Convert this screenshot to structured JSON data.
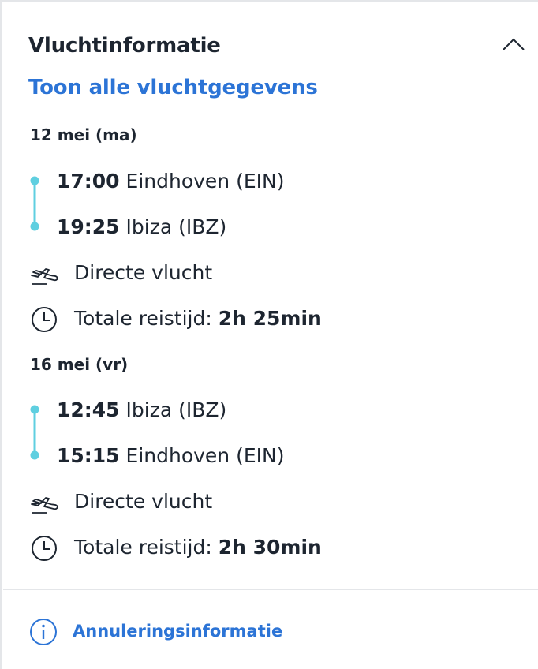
{
  "panel": {
    "title": "Vluchtinformatie",
    "show_all_link": "Toon alle vluchtgegevens",
    "accent_color": "#2c74d6",
    "timeline_color": "#5fcfe0"
  },
  "outbound": {
    "date": "12 mei (ma)",
    "departure": {
      "time": "17:00",
      "place": "Eindhoven (EIN)"
    },
    "arrival": {
      "time": "19:25",
      "place": "Ibiza (IBZ)"
    },
    "flight_type": "Directe vlucht",
    "duration_label": "Totale reistijd:",
    "duration_value": "2h 25min"
  },
  "return": {
    "date": "16 mei (vr)",
    "departure": {
      "time": "12:45",
      "place": "Ibiza (IBZ)"
    },
    "arrival": {
      "time": "15:15",
      "place": "Eindhoven (EIN)"
    },
    "flight_type": "Directe vlucht",
    "duration_label": "Totale reistijd:",
    "duration_value": "2h 30min"
  },
  "footer": {
    "cancellation_link": "Annuleringsinformatie"
  },
  "icons": {
    "collapse": "chevron-up-icon",
    "flight": "plane-icon",
    "duration": "clock-icon",
    "info": "info-icon"
  }
}
